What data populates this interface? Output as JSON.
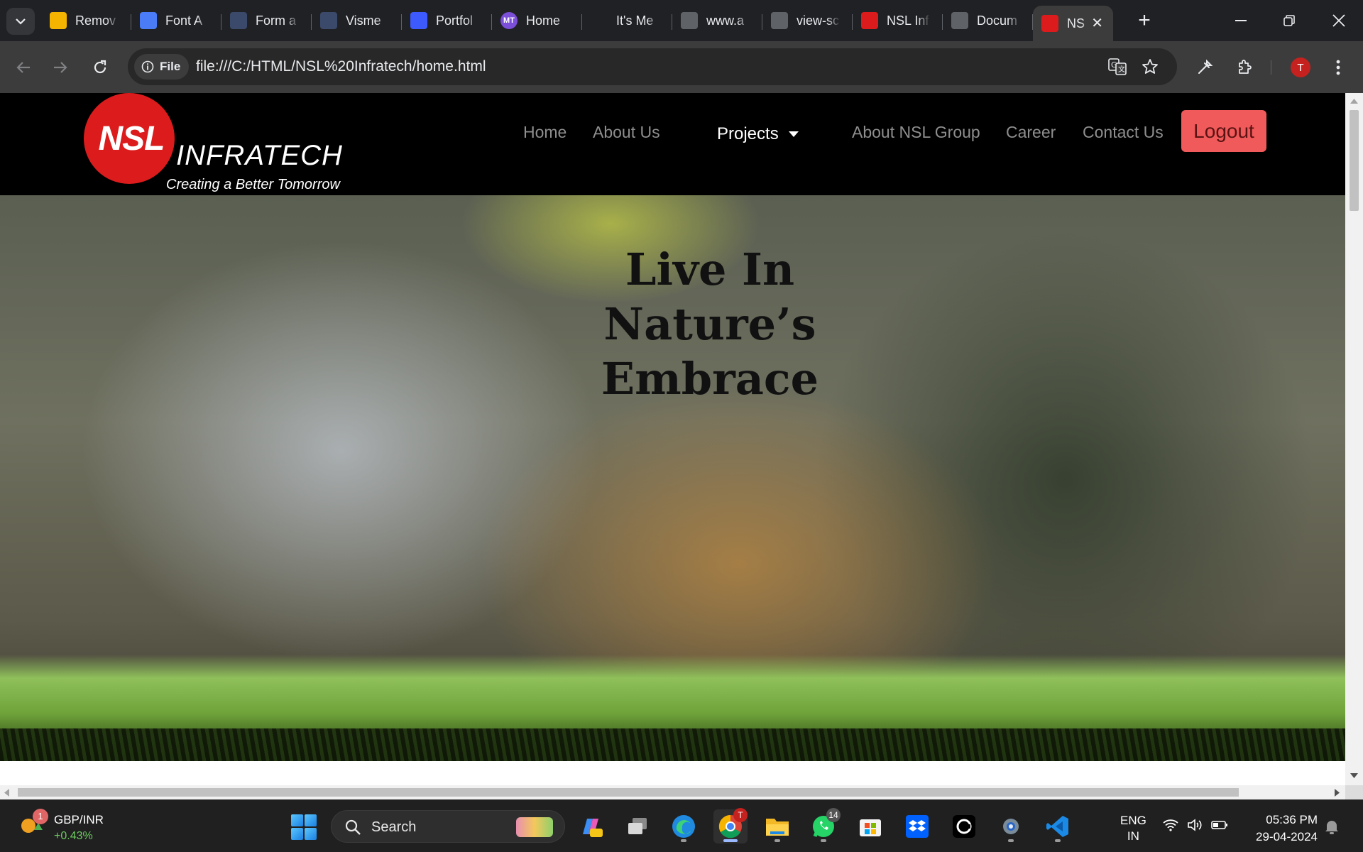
{
  "browser": {
    "tabs": [
      {
        "title": "Remov",
        "fav_color": "#f4b400"
      },
      {
        "title": "Font A",
        "fav_color": "#4a7cf7"
      },
      {
        "title": "Form a",
        "fav_color": "#3b4a6b"
      },
      {
        "title": "Visme",
        "fav_color": "#3b4a6b"
      },
      {
        "title": "Portfol",
        "fav_color": "#3d5afe"
      },
      {
        "title": "Home",
        "fav_color": "#7b4fd8",
        "fav_text": "MT"
      },
      {
        "title": "It's Me",
        "fav_color": "#202124"
      },
      {
        "title": "www.a",
        "fav_color": "#5f6368"
      },
      {
        "title": "view-sc",
        "fav_color": "#5f6368"
      },
      {
        "title": "NSL Inf",
        "fav_color": "#dc1c1c"
      },
      {
        "title": "Docum",
        "fav_color": "#5f6368"
      }
    ],
    "active_tab": {
      "title": "NS",
      "fav_color": "#dc1c1c"
    },
    "chip_label": "File",
    "url": "file:///C:/HTML/NSL%20Infratech/home.html",
    "profile_initial": "T"
  },
  "site": {
    "logo": {
      "mark": "NSL",
      "word": "INFRATECH",
      "tagline": "Creating a Better Tomorrow"
    },
    "nav": {
      "home": "Home",
      "about": "About Us",
      "projects": "Projects",
      "group": "About NSL Group",
      "career": "Career",
      "contact": "Contact Us",
      "logout": "Logout"
    },
    "hero": {
      "line1": "Live In",
      "line2": "Nature’s",
      "line3": "Embrace"
    }
  },
  "taskbar": {
    "widget": {
      "badge": "1",
      "pair": "GBP/INR",
      "change": "+0.43%"
    },
    "search_placeholder": "Search",
    "chrome_badge": "T",
    "whatsapp_badge": "14",
    "lang_line1": "ENG",
    "lang_line2": "IN",
    "time": "05:36 PM",
    "date": "29-04-2024"
  },
  "colors": {
    "brand_red": "#dc1c1c",
    "logout_bg": "#f15a5a",
    "nav_bg": "#000000"
  }
}
